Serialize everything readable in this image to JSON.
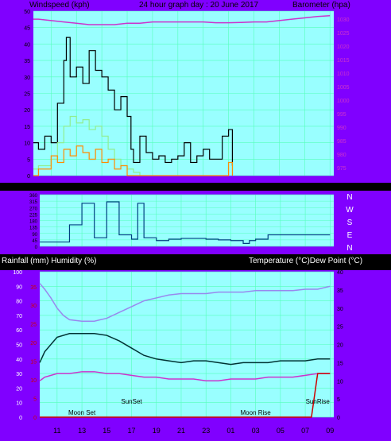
{
  "header": {
    "top_left_label": "Windspeed (kph)",
    "top_title": "24 hour graph day : 20 June 2017",
    "top_right_label": "Barometer (hpa)",
    "bottom_left_label": "Rainfall (mm)  Humidity (%)",
    "bottom_right_label": "Temperature (°C)Dew Point (°C)"
  },
  "colors": {
    "frame_purple": "#8000ff",
    "plot_cyan": "#9ff",
    "wind_gust": "#000000",
    "wind_avg": "#90ee90",
    "wind_orange": "#ff8c00",
    "barometer": "#cc33cc",
    "direction": "#004080",
    "humidity": "#9988ee",
    "temperature": "#003333",
    "dewpoint": "#cc33cc",
    "rainfall": "#cc0000"
  },
  "chart_data": [
    {
      "type": "line",
      "title": "24 hour graph day : 20 June 2017",
      "x_ticks": [
        "11",
        "13",
        "15",
        "17",
        "19",
        "21",
        "23",
        "01",
        "03",
        "05",
        "07",
        "09"
      ],
      "ylabel": "Windspeed (kph)",
      "y_ticks": [
        "0",
        "5",
        "10",
        "15",
        "20",
        "25",
        "30",
        "35",
        "40",
        "45",
        "50"
      ],
      "ylim": [
        0,
        50
      ],
      "y2label": "Barometer (hpa)",
      "y2_ticks": [
        "975",
        "980",
        "985",
        "990",
        "995",
        "1000",
        "1005",
        "1010",
        "1015",
        "1020",
        "1025",
        "1030"
      ],
      "y2lim": [
        972,
        1033
      ],
      "grid": true,
      "series": [
        {
          "key": "gust",
          "x": [
            9.6,
            10,
            10.5,
            11,
            11.5,
            12,
            12.2,
            12.5,
            13,
            13.5,
            14,
            14.5,
            15,
            15.5,
            16,
            16.5,
            17,
            17.3,
            17.5,
            18,
            18.5,
            19,
            19.5,
            20,
            20.5,
            21,
            21.5,
            22,
            22.5,
            23,
            23.5,
            24,
            24.5,
            25,
            25.3
          ],
          "values": [
            10,
            8,
            12,
            10,
            22,
            35,
            42,
            30,
            33,
            28,
            38,
            32,
            30,
            26,
            20,
            24,
            18,
            8,
            4,
            12,
            7,
            5,
            6,
            4,
            5,
            6,
            10,
            4,
            6,
            8,
            5,
            5,
            12,
            14,
            3
          ]
        },
        {
          "key": "average",
          "x": [
            9.6,
            10,
            11,
            11.5,
            12,
            12.5,
            13,
            13.5,
            14,
            14.5,
            15,
            15.5,
            16,
            16.5,
            17,
            17.5,
            18
          ],
          "values": [
            2,
            3,
            5,
            10,
            15,
            18,
            16,
            17,
            14,
            15,
            12,
            8,
            5,
            3,
            2,
            1,
            0
          ]
        },
        {
          "key": "wind_orange",
          "x": [
            9.6,
            10,
            11,
            11.5,
            12,
            12.5,
            13,
            13.5,
            14,
            14.5,
            15,
            15.5,
            16,
            16.5,
            17,
            25,
            25.3
          ],
          "values": [
            0,
            2,
            6,
            4,
            8,
            6,
            9,
            7,
            5,
            8,
            4,
            5,
            2,
            3,
            0,
            4,
            0
          ]
        },
        {
          "key": "barometer",
          "x": [
            9.6,
            10,
            11,
            12,
            13,
            14,
            15,
            16,
            17,
            18,
            19,
            20,
            21,
            22,
            23,
            24,
            25,
            26,
            27,
            28,
            29,
            30,
            31,
            32,
            33
          ],
          "values": [
            1030,
            1030,
            1029.5,
            1029,
            1028.5,
            1028,
            1028,
            1028,
            1028.5,
            1028.5,
            1029,
            1029,
            1029,
            1029,
            1029,
            1028.7,
            1028.7,
            1028.8,
            1029,
            1029,
            1029.5,
            1030,
            1030.5,
            1031,
            1031.3
          ]
        }
      ]
    },
    {
      "type": "line",
      "title": "",
      "x_ticks": [],
      "y_ticks": [
        "0",
        "45",
        "90",
        "135",
        "180",
        "225",
        "270",
        "315",
        "360"
      ],
      "ylim": [
        0,
        360
      ],
      "right_labels": [
        "N",
        "W",
        "S",
        "E",
        "N"
      ],
      "grid": true,
      "series": [
        {
          "key": "direction",
          "x": [
            9.6,
            11,
            12,
            13,
            14,
            15,
            16,
            17,
            17.5,
            18,
            19,
            20,
            21,
            22,
            23,
            24,
            25,
            26,
            26.5,
            27,
            28,
            30,
            33
          ],
          "values": [
            30,
            30,
            150,
            300,
            60,
            310,
            80,
            50,
            300,
            60,
            40,
            50,
            55,
            55,
            50,
            45,
            40,
            20,
            40,
            50,
            80,
            80,
            80
          ]
        }
      ]
    },
    {
      "type": "line",
      "title": "",
      "x_ticks": [
        "11",
        "13",
        "15",
        "17",
        "19",
        "21",
        "23",
        "01",
        "03",
        "05",
        "07",
        "09"
      ],
      "ylabel": "Rainfall (mm)  Humidity (%)",
      "y_ticks": [
        "0",
        "10",
        "20",
        "30",
        "40",
        "50",
        "60",
        "70",
        "80",
        "90",
        "100"
      ],
      "ylim": [
        0,
        100
      ],
      "rain_ticks": [
        "0",
        "5",
        "10",
        "15",
        "20",
        "25",
        "30",
        "35"
      ],
      "y2label": "Temperature (°C)Dew Point (°C)",
      "y2_ticks": [
        "0",
        "5",
        "10",
        "15",
        "20",
        "25",
        "30",
        "35",
        "40"
      ],
      "y2lim": [
        0,
        40
      ],
      "grid": true,
      "annotations": [
        "Moon Set",
        "SunSet",
        "Moon Rise",
        "SunRise"
      ],
      "series": [
        {
          "key": "humidity",
          "x": [
            9.6,
            10,
            10.5,
            11,
            11.5,
            12,
            13,
            14,
            15,
            16,
            17,
            18,
            19,
            20,
            21,
            22,
            23,
            24,
            25,
            26,
            27,
            28,
            29,
            30,
            31,
            32,
            33
          ],
          "values": [
            92,
            88,
            82,
            75,
            70,
            67,
            66,
            66,
            68,
            72,
            76,
            80,
            82,
            84,
            85,
            85,
            85,
            86,
            86,
            86,
            87,
            87,
            87,
            87,
            88,
            88,
            90
          ]
        },
        {
          "key": "temperature",
          "x": [
            9.6,
            10,
            11,
            12,
            13,
            14,
            15,
            16,
            17,
            18,
            19,
            20,
            21,
            22,
            23,
            24,
            25,
            26,
            27,
            28,
            29,
            30,
            31,
            32,
            33
          ],
          "values": [
            15,
            18,
            22,
            23,
            23,
            23,
            22.5,
            21,
            19,
            17,
            16,
            15.5,
            15,
            15.5,
            15.5,
            15,
            14.5,
            15,
            15,
            15,
            15.5,
            15.5,
            15.5,
            16,
            16
          ]
        },
        {
          "key": "dewpoint",
          "x": [
            9.6,
            10,
            11,
            12,
            13,
            14,
            15,
            16,
            17,
            18,
            19,
            20,
            21,
            22,
            23,
            24,
            25,
            26,
            27,
            28,
            29,
            30,
            31,
            32,
            33
          ],
          "values": [
            10,
            11,
            12,
            12,
            12.5,
            12.5,
            12,
            12,
            11.5,
            11,
            11,
            10.5,
            10.5,
            10.5,
            10,
            10,
            10.5,
            10.5,
            10.5,
            11,
            11,
            11,
            11.5,
            12,
            12
          ]
        },
        {
          "key": "rainfall",
          "x": [
            9.6,
            31.5,
            32,
            33
          ],
          "values": [
            0,
            0,
            0.3,
            0.3
          ]
        }
      ]
    }
  ]
}
